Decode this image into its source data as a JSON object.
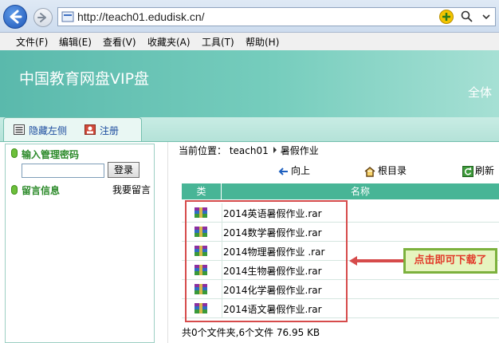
{
  "browser": {
    "url": "http://teach01.edudisk.cn/",
    "menu": [
      "文件(F)",
      "编辑(E)",
      "查看(V)",
      "收藏夹(A)",
      "工具(T)",
      "帮助(H)"
    ]
  },
  "header": {
    "title": "中国教育网盘VIP盘",
    "marquee": "全体"
  },
  "tabs": {
    "hide_left": "隐藏左侧",
    "register": "注册"
  },
  "sidebar": {
    "password_heading": "输入管理密码",
    "password_value": "",
    "login_label": "登录",
    "message_heading": "留言信息",
    "leave_message_label": "我要留言"
  },
  "main": {
    "breadcrumb_prefix": "当前位置：",
    "breadcrumb_root": "teach01",
    "breadcrumb_current": "暑假作业",
    "toolbar": {
      "up": "向上",
      "root": "根目录",
      "refresh": "刷新"
    },
    "columns": {
      "type": "类",
      "name": "名称"
    },
    "files": [
      {
        "name": "2014英语暑假作业.rar"
      },
      {
        "name": "2014数学暑假作业.rar"
      },
      {
        "name": "2014物理暑假作业 .rar"
      },
      {
        "name": "2014生物暑假作业.rar"
      },
      {
        "name": "2014化学暑假作业.rar"
      },
      {
        "name": "2014语文暑假作业.rar"
      }
    ],
    "summary": "共0个文件夹,6个文件 76.95 KB"
  },
  "annotation": {
    "callout": "点击即可下载了",
    "color": "#d64b4b"
  }
}
